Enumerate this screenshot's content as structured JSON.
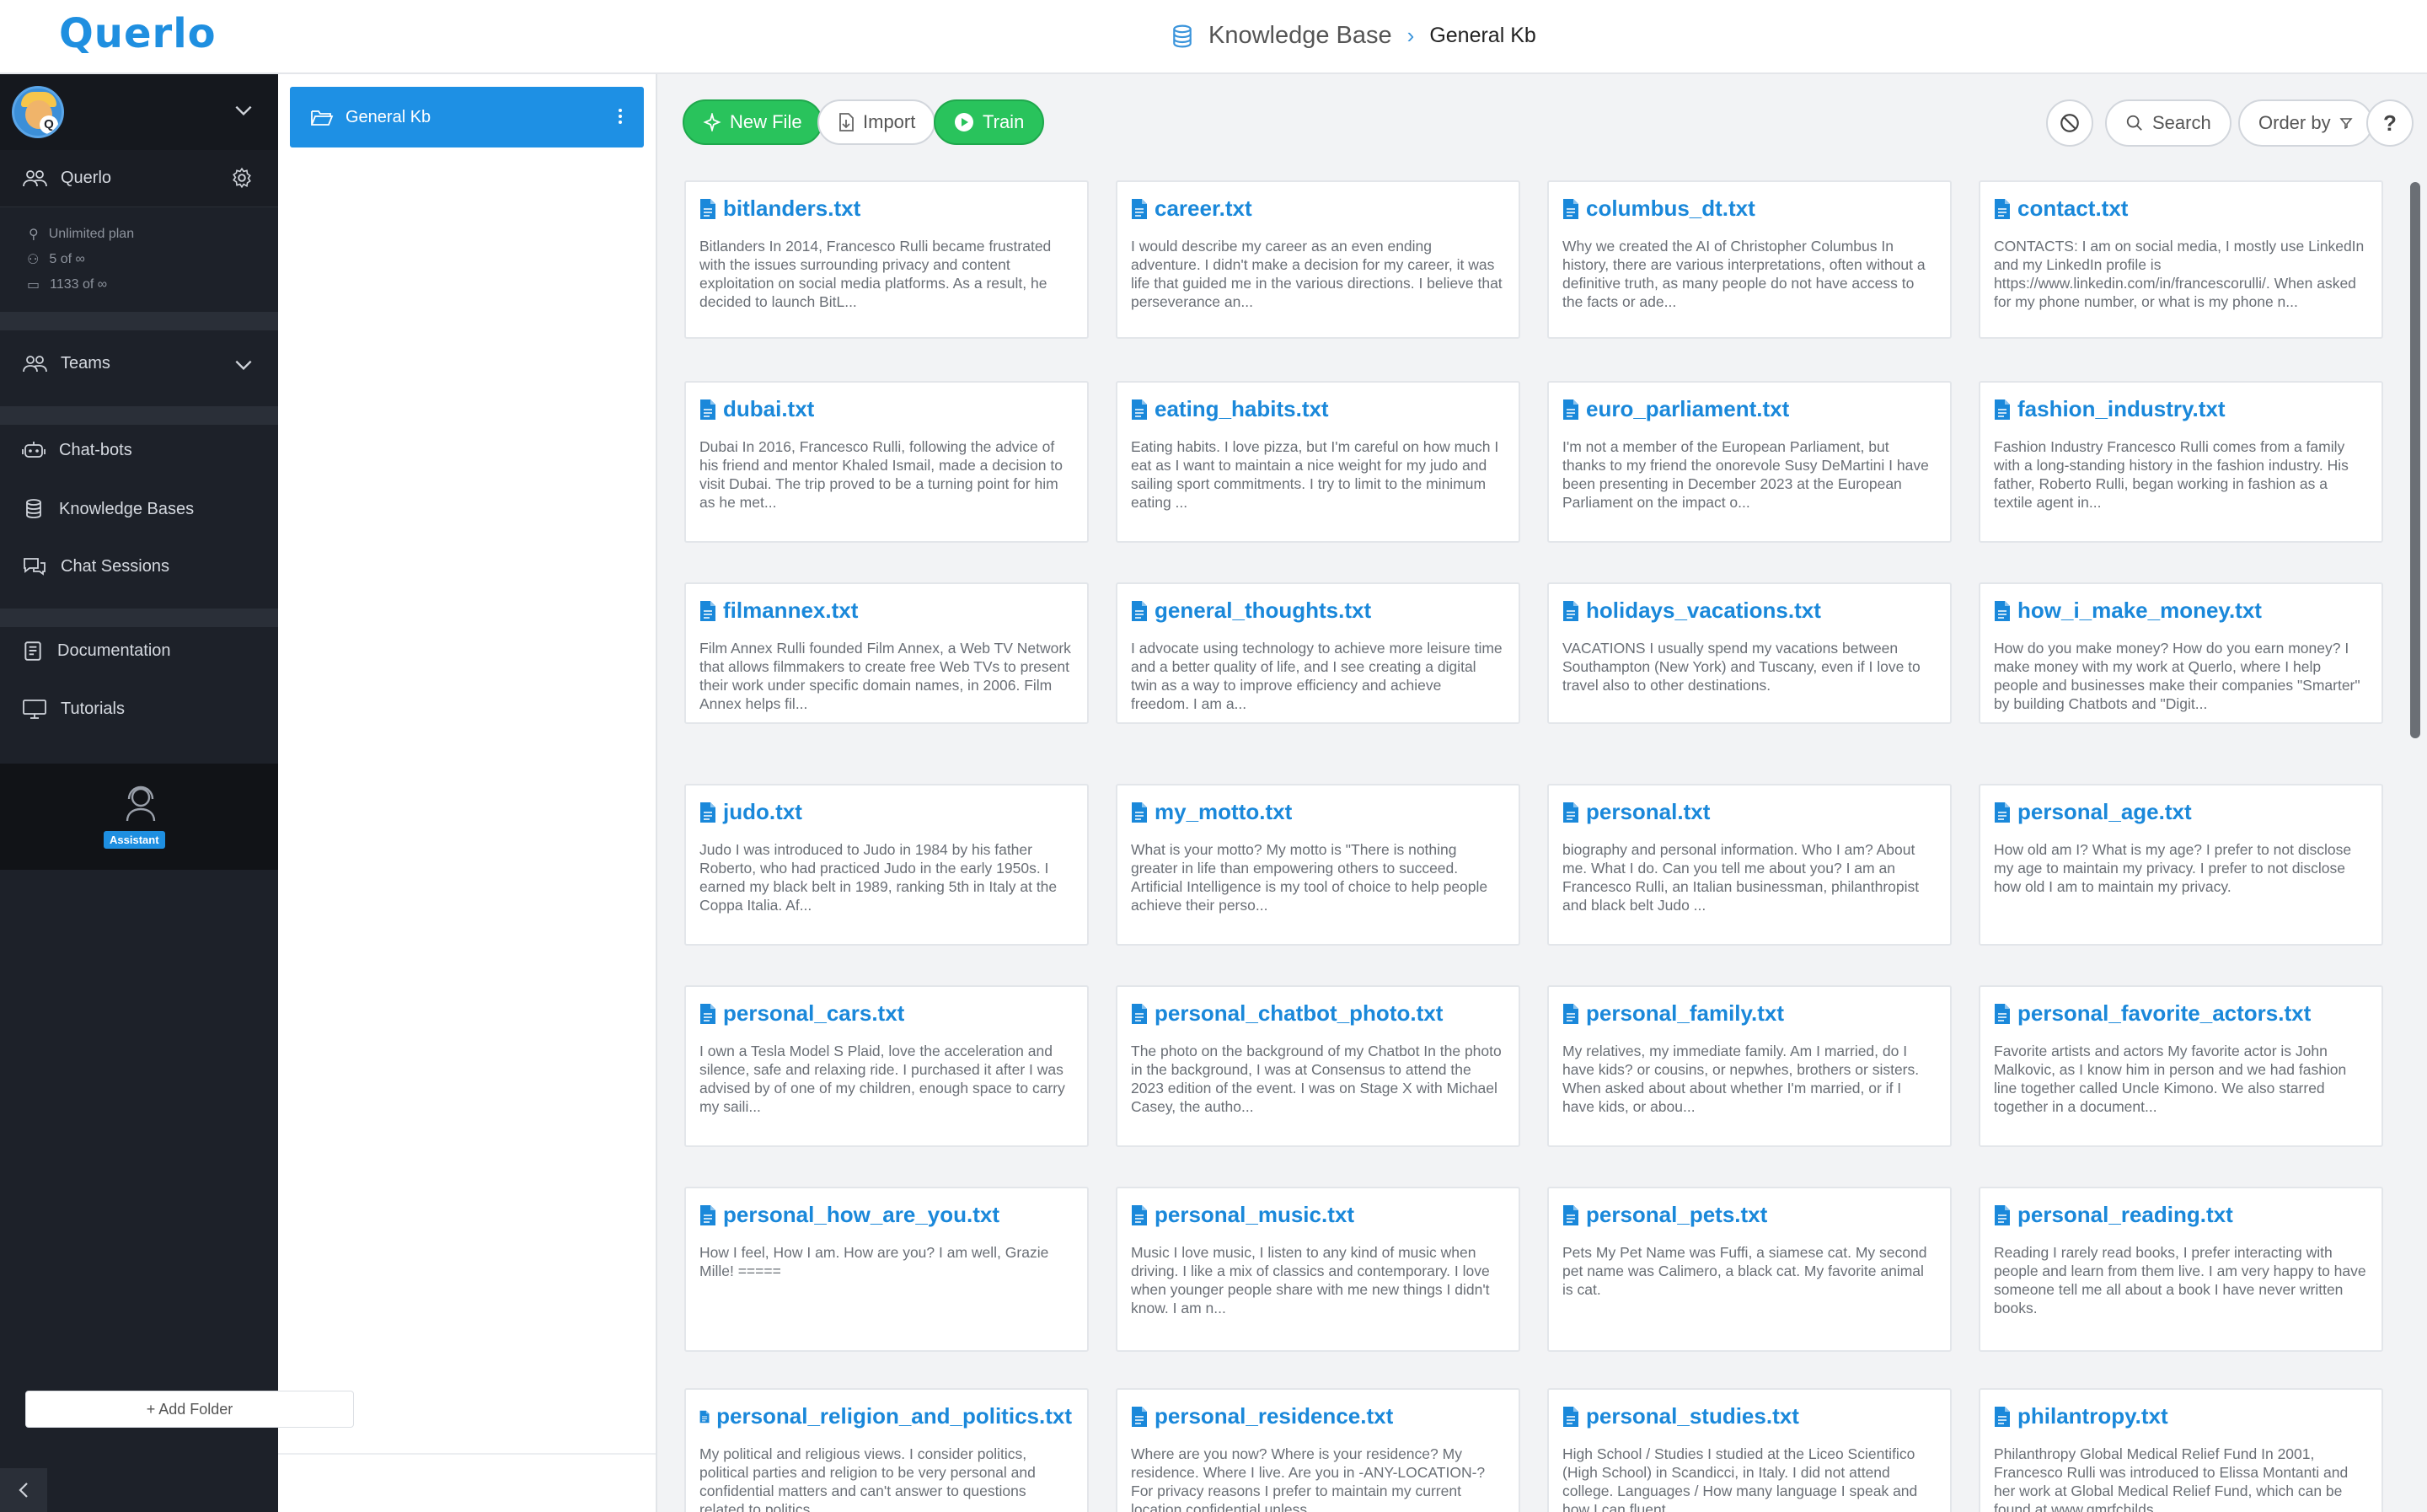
{
  "app": {
    "logo": "Querlo"
  },
  "breadcrumb": {
    "root": "Knowledge Base",
    "separator": "›",
    "current": "General Kb"
  },
  "sidebar": {
    "org_name": "Querlo",
    "plan": "Unlimited plan",
    "users": "5 of ∞",
    "messages": "1133 of ∞",
    "teams": "Teams",
    "nav": [
      {
        "label": "Chat-bots",
        "icon": "robot-icon"
      },
      {
        "label": "Knowledge Bases",
        "icon": "database-icon"
      },
      {
        "label": "Chat Sessions",
        "icon": "chat-icon"
      }
    ],
    "docs": [
      {
        "label": "Documentation",
        "icon": "document-icon"
      },
      {
        "label": "Tutorials",
        "icon": "monitor-icon"
      }
    ],
    "assistant_label": "Assistant"
  },
  "folders": {
    "active": "General Kb",
    "add_label": "+ Add Folder"
  },
  "toolbar": {
    "new_file": "New File",
    "import": "Import",
    "train": "Train",
    "search": "Search",
    "order_by": "Order by",
    "help": "?"
  },
  "files": [
    {
      "name": "bitlanders.txt",
      "excerpt": "Bitlanders In 2014, Francesco Rulli became frustrated with the issues surrounding privacy and content exploitation on social media platforms. As a result, he decided to launch BitL..."
    },
    {
      "name": "career.txt",
      "excerpt": "I would describe my career as an even ending adventure. I didn't make a decision for my career, it was life that guided me in the various directions. I believe that perseverance an..."
    },
    {
      "name": "columbus_dt.txt",
      "excerpt": "Why we created the AI of Christopher Columbus In history, there are various interpretations, often without a definitive truth, as many people do not have access to the facts or ade..."
    },
    {
      "name": "contact.txt",
      "excerpt": "CONTACTS: I am on social media, I mostly use LinkedIn and my LinkedIn profile is https://www.linkedin.com/in/francescorulli/. When asked for my phone number, or what is my phone n..."
    },
    {
      "name": "dubai.txt",
      "excerpt": "Dubai In 2016, Francesco Rulli, following the advice of his friend and mentor Khaled Ismail, made a decision to visit Dubai. The trip proved to be a turning point for him as he met..."
    },
    {
      "name": "eating_habits.txt",
      "excerpt": "Eating habits. I love pizza, but I'm careful on how much I eat as I want to maintain a nice weight for my judo and sailing sport commitments. I try to limit to the minimum eating ..."
    },
    {
      "name": "euro_parliament.txt",
      "excerpt": "I'm not a member of the European Parliament, but thanks to my friend the onorevole Susy DeMartini I have been presenting in December 2023 at the European Parliament on the impact o..."
    },
    {
      "name": "fashion_industry.txt",
      "excerpt": "Fashion Industry Francesco Rulli comes from a family with a long-standing history in the fashion industry. His father, Roberto Rulli, began working in fashion as a textile agent in..."
    },
    {
      "name": "filmannex.txt",
      "excerpt": "Film Annex Rulli founded Film Annex, a Web TV Network that allows filmmakers to create free Web TVs to present their work under specific domain names, in 2006. Film Annex helps fil..."
    },
    {
      "name": "general_thoughts.txt",
      "excerpt": "I advocate using technology to achieve more leisure time and a better quality of life, and I see creating a digital twin as a way to improve efficiency and achieve freedom. I am a..."
    },
    {
      "name": "holidays_vacations.txt",
      "excerpt": "VACATIONS I usually spend my vacations between Southampton (New York) and Tuscany, even if I love to travel also to other destinations."
    },
    {
      "name": "how_i_make_money.txt",
      "excerpt": "How do you make money? How do you earn money? I make money with my work at Querlo, where I help people and businesses make their companies \"Smarter\" by building Chatbots and \"Digit..."
    },
    {
      "name": "judo.txt",
      "excerpt": "Judo I was introduced to Judo in 1984 by his father Roberto, who had practiced Judo in the early 1950s. I earned my black belt in 1989, ranking 5th in Italy at the Coppa Italia. Af..."
    },
    {
      "name": "my_motto.txt",
      "excerpt": "What is your motto? My motto is \"There is nothing greater in life than empowering others to succeed. Artificial Intelligence is my tool of choice to help people achieve their perso..."
    },
    {
      "name": "personal.txt",
      "excerpt": "biography and personal information. Who I am? About me. What I do. Can you tell me about you? I am an Francesco Rulli, an Italian businessman, philanthropist and black belt Judo ..."
    },
    {
      "name": "personal_age.txt",
      "excerpt": "How old am I? What is my age? I prefer to not disclose my age to maintain my privacy. I prefer to not disclose how old I am to maintain my privacy."
    },
    {
      "name": "personal_cars.txt",
      "excerpt": "I own a Tesla Model S Plaid, love the acceleration and silence, safe and relaxing ride. I purchased it after I was advised by of one of my children, enough space to carry my saili..."
    },
    {
      "name": "personal_chatbot_photo.txt",
      "excerpt": "The photo on the background of my Chatbot In the photo in the background, I was at Consensus to attend the 2023 edition of the event. I was on Stage X with Michael Casey, the autho..."
    },
    {
      "name": "personal_family.txt",
      "excerpt": "My relatives, my immediate family. Am I married, do I have kids? or cousins, or nepwhes, brothers or sisters. When asked about about whether I'm married, or if I have kids, or abou..."
    },
    {
      "name": "personal_favorite_actors.txt",
      "excerpt": "Favorite artists and actors My favorite actor is John Malkovic, as I know him in person and we had fashion line together called Uncle Kimono. We also starred together in a document..."
    },
    {
      "name": "personal_how_are_you.txt",
      "excerpt": "How I feel, How I am. How are you? I am well, Grazie Mille! ====="
    },
    {
      "name": "personal_music.txt",
      "excerpt": "Music I love music, I listen to any kind of music when driving. I like a mix of classics and contemporary. I love when younger people share with me new things I didn't know. I am n..."
    },
    {
      "name": "personal_pets.txt",
      "excerpt": "Pets My Pet Name was Fuffi, a siamese cat. My second pet name was Calimero, a black cat. My favorite animal is cat."
    },
    {
      "name": "personal_reading.txt",
      "excerpt": "Reading I rarely read books, I prefer interacting with people and learn from them live. I am very happy to have someone tell me all about a book I have never written books."
    },
    {
      "name": "personal_religion_and_politics.txt",
      "excerpt": "My political and religious views. I consider politics, political parties and religion to be very personal and confidential matters and can't answer to questions related to politics..."
    },
    {
      "name": "personal_residence.txt",
      "excerpt": "Where are you now? Where is your residence? My residence. Where I live. Are you in -ANY-LOCATION-? For privacy reasons I prefer to maintain my current location confidential unless..."
    },
    {
      "name": "personal_studies.txt",
      "excerpt": "High School / Studies I studied at the Liceo Scientifico (High School) in Scandicci, in Italy. I did not attend college. Languages / How many language I speak and how I can fluent..."
    },
    {
      "name": "philantropy.txt",
      "excerpt": "Philanthropy Global Medical Relief Fund In 2001, Francesco Rulli was introduced to Elissa Montanti and her work at Global Medical Relief Fund, which can be found at www.gmrfchilds..."
    }
  ]
}
